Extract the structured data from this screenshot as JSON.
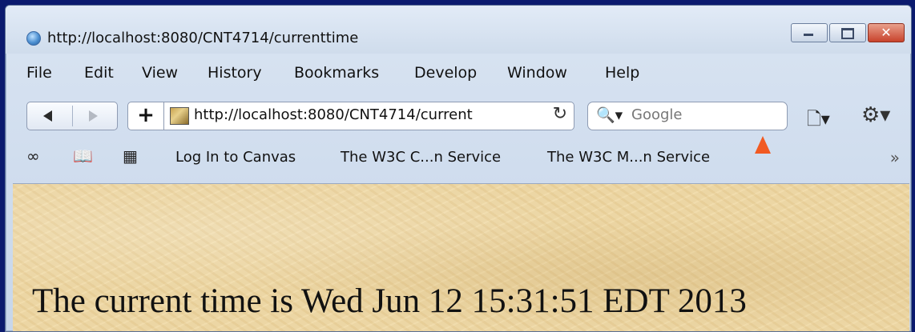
{
  "window": {
    "title": "http://localhost:8080/CNT4714/currenttime",
    "close_glyph": "✕"
  },
  "menu": {
    "file": "File",
    "edit": "Edit",
    "view": "View",
    "history": "History",
    "bookmarks": "Bookmarks",
    "develop": "Develop",
    "window": "Window",
    "help": "Help"
  },
  "navbar": {
    "url": "http://localhost:8080/CNT4714/current",
    "search_placeholder": "Google",
    "reload_glyph": "↻",
    "plus_glyph": "+",
    "search_glyph": "🔍▾",
    "page_menu_glyph": "🗋▾",
    "gear_glyph": "⚙▾"
  },
  "bookmarks": {
    "reader_icon": "∞",
    "book_icon": "📖",
    "grid_icon": "▦",
    "items": [
      "Log In to Canvas",
      "The W3C C...n Service",
      "The W3C M...n Service"
    ],
    "more": "»"
  },
  "page": {
    "text": "The current time is Wed Jun 12 15:31:51 EDT 2013"
  },
  "colors": {
    "background": "#0b1a6e",
    "page_bg": "#ecd6a4",
    "cursor": "#f15a22"
  }
}
